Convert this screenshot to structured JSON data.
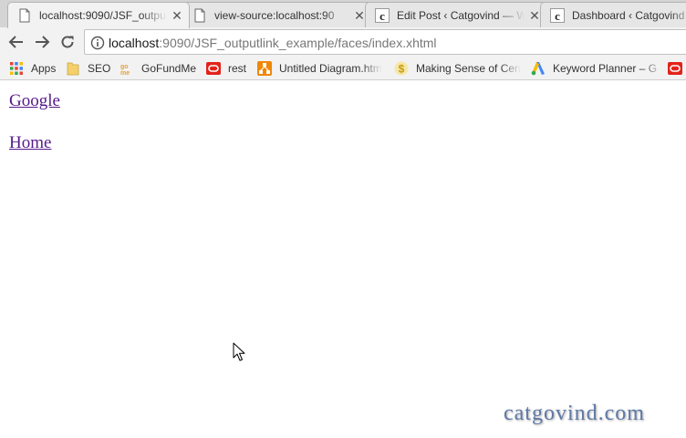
{
  "tabs": [
    {
      "title": "localhost:9090/JSF_outpu",
      "active": true,
      "icon": "page-icon"
    },
    {
      "title": "view-source:localhost:90",
      "active": false,
      "icon": "page-icon"
    },
    {
      "title": "Edit Post ‹ Catgovind — W",
      "active": false,
      "icon": "catgovind-favicon-icon"
    },
    {
      "title": "Dashboard ‹ Catgovind -",
      "active": false,
      "icon": "catgovind-favicon-icon"
    }
  ],
  "toolbar": {
    "url_host": "localhost",
    "url_path": ":9090/JSF_outputlink_example/faces/index.xhtml"
  },
  "bookmarks": [
    {
      "label": "Apps",
      "icon": "apps-grid-icon"
    },
    {
      "label": "SEO",
      "icon": "folder-icon"
    },
    {
      "label": "GoFundMe",
      "icon": "gofundme-icon"
    },
    {
      "label": "rest",
      "icon": "oracle-icon"
    },
    {
      "label": "Untitled Diagram.htm",
      "icon": "drawio-icon"
    },
    {
      "label": "Making Sense of Cen",
      "icon": "dollar-coin-icon"
    },
    {
      "label": "Keyword Planner – Go",
      "icon": "google-ads-icon"
    }
  ],
  "page": {
    "links": [
      "Google",
      "Home"
    ]
  },
  "watermark": "catgovind.com",
  "colors": {
    "visited_link": "#551a8b",
    "watermark": "#5f79a6"
  }
}
